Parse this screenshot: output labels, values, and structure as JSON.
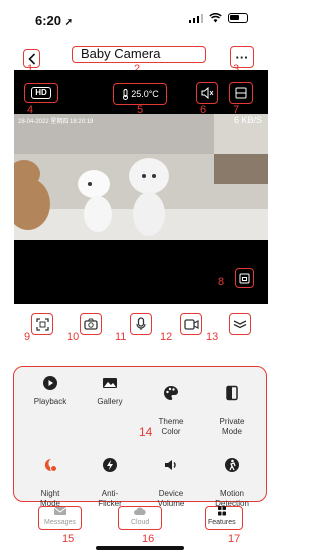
{
  "status_bar": {
    "time": "6:20"
  },
  "nav": {
    "title": "Baby Camera",
    "back_icon": "chevron-left-icon",
    "more_label": "···"
  },
  "camera": {
    "hd_label": "HD",
    "temperature": "25.0°C",
    "timestamp": "28-04-2022 星期四 18:20:19",
    "bitrate": "6 KB/S"
  },
  "features": [
    {
      "label": "Playback",
      "icon": "playback-icon"
    },
    {
      "label": "Gallery",
      "icon": "gallery-icon"
    },
    {
      "label": "Theme\nColor",
      "icon": "palette-icon"
    },
    {
      "label": "Private\nMode",
      "icon": "private-mode-icon"
    },
    {
      "label": "Night\nMode",
      "icon": "night-mode-icon"
    },
    {
      "label": "Anti-\nFlicker",
      "icon": "flash-icon"
    },
    {
      "label": "Device\nVolume",
      "icon": "volume-icon"
    },
    {
      "label": "Motion\nDetection",
      "icon": "motion-icon"
    }
  ],
  "tabs": [
    {
      "label": "Messages",
      "icon": "mail-icon"
    },
    {
      "label": "Cloud",
      "icon": "cloud-icon"
    },
    {
      "label": "Features",
      "icon": "grid-icon"
    }
  ],
  "annotations": [
    "1",
    "2",
    "3",
    "4",
    "5",
    "6",
    "7",
    "8",
    "9",
    "10",
    "11",
    "12",
    "13",
    "14",
    "15",
    "16",
    "17"
  ],
  "colors": {
    "annotation": "#e53935",
    "night_mode": "#e8532b"
  }
}
